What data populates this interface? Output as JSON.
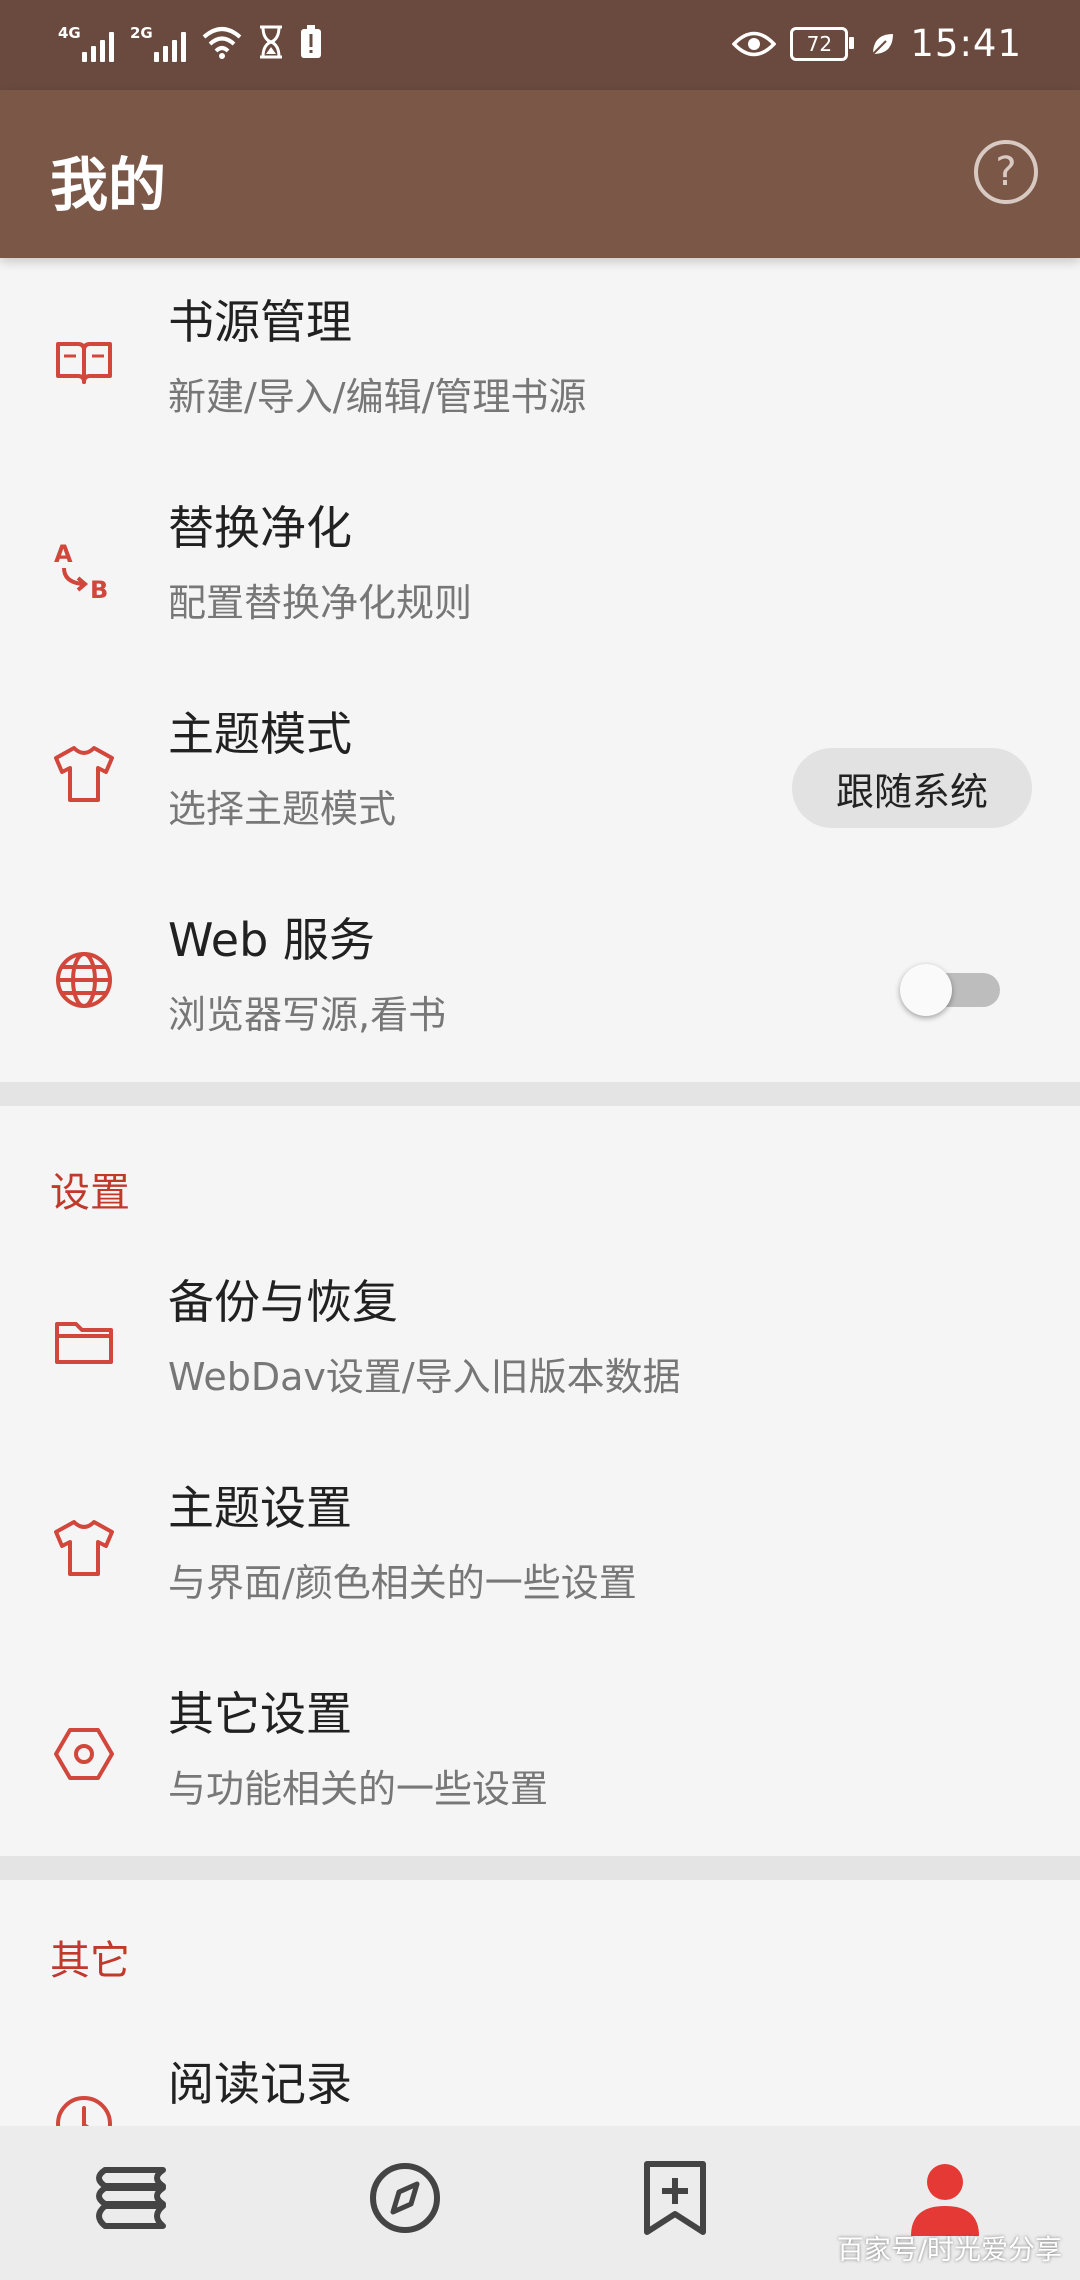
{
  "status_bar": {
    "network1": "4G",
    "network2": "2G",
    "battery": "72",
    "time": "15:41"
  },
  "appbar": {
    "title": "我的"
  },
  "items": [
    {
      "title": "书源管理",
      "subtitle": "新建/导入/编辑/管理书源"
    },
    {
      "title": "替换净化",
      "subtitle": "配置替换净化规则"
    },
    {
      "title": "主题模式",
      "subtitle": "选择主题模式",
      "value": "跟随系统"
    },
    {
      "title": "Web 服务",
      "subtitle": "浏览器写源,看书",
      "enabled": false
    },
    {
      "title": "备份与恢复",
      "subtitle": "WebDav设置/导入旧版本数据"
    },
    {
      "title": "主题设置",
      "subtitle": "与界面/颜色相关的一些设置"
    },
    {
      "title": "其它设置",
      "subtitle": "与功能相关的一些设置"
    },
    {
      "title": "阅读记录",
      "subtitle": ""
    }
  ],
  "sections": {
    "settings": "设置",
    "other": "其它"
  },
  "watermark": "百家号/时光爱分享",
  "colors": {
    "accent": "#d2473c",
    "appbar": "#7b5747",
    "statusbar": "#6a4a3e",
    "selected_nav": "#e53935"
  }
}
